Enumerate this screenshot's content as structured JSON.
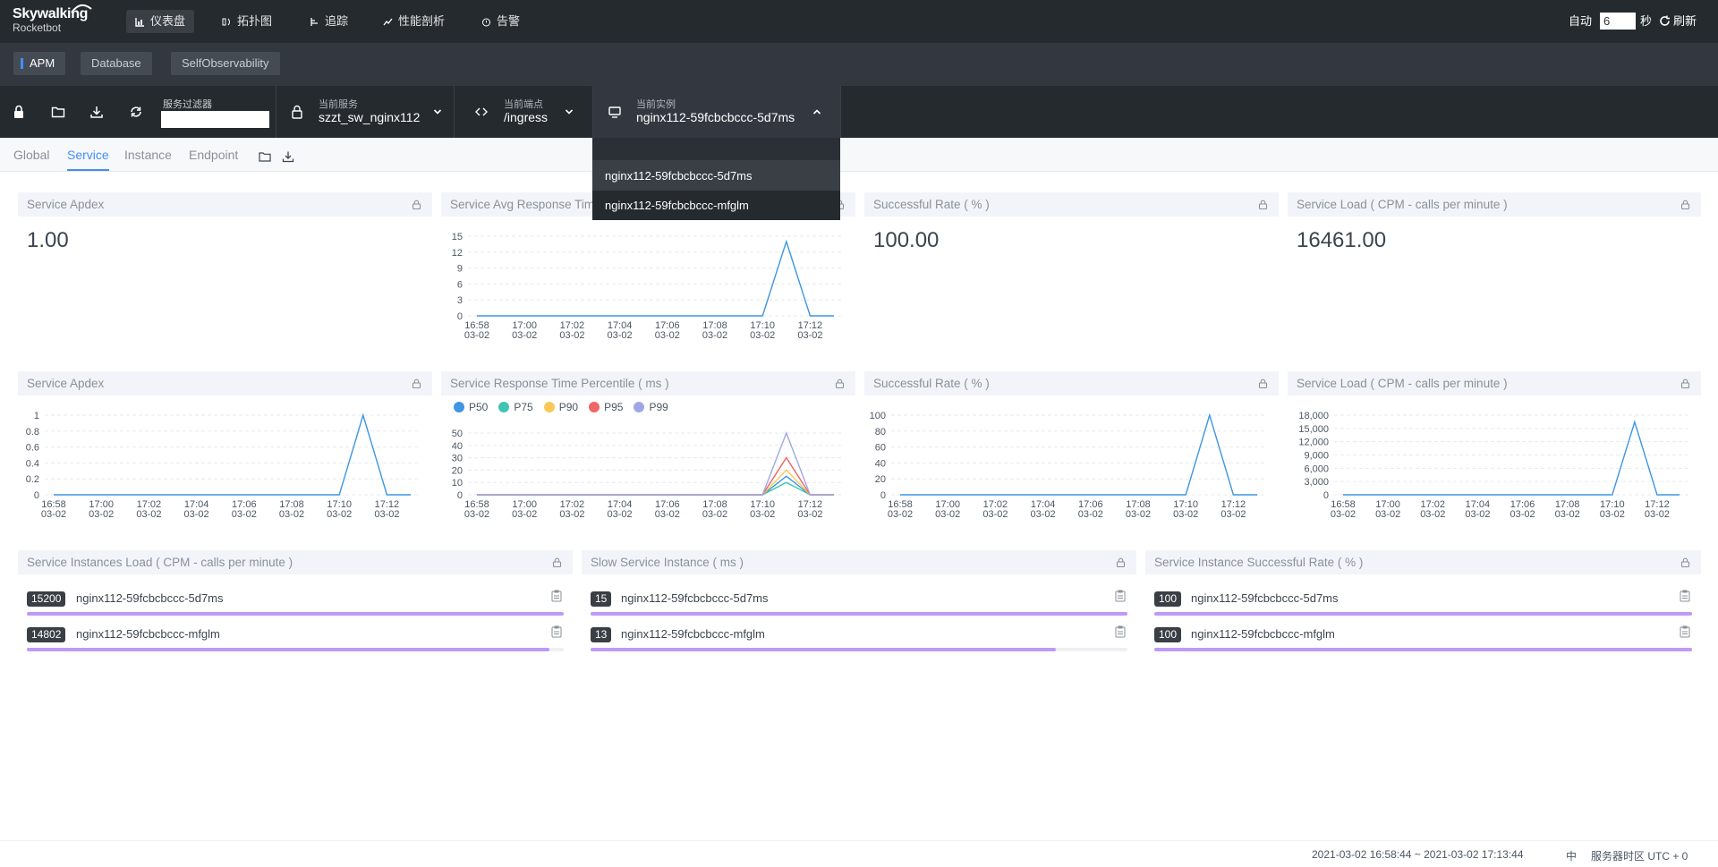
{
  "app": {
    "brand": "Skywalking",
    "sub": "Rocketbot"
  },
  "nav": [
    {
      "label": "仪表盘",
      "icon": "dashboard-icon"
    },
    {
      "label": "拓扑图",
      "icon": "topology-icon"
    },
    {
      "label": "追踪",
      "icon": "trace-icon"
    },
    {
      "label": "性能剖析",
      "icon": "profile-icon"
    },
    {
      "label": "告警",
      "icon": "alarm-icon"
    }
  ],
  "auto_refresh": {
    "auto_label": "自动",
    "interval": "6",
    "unit": "秒",
    "refresh_label": "刷新"
  },
  "subtabs": [
    "APM",
    "Database",
    "SelfObservability"
  ],
  "toolbar": {
    "filter_label": "服务过滤器",
    "service_label": "当前服务",
    "service_value": "szzt_sw_nginx112",
    "endpoint_label": "当前端点",
    "endpoint_value": "/ingress",
    "instance_label": "当前实例",
    "instance_value": "nginx112-59fcbcbccc-5d7ms"
  },
  "dropdown": {
    "items": [
      "nginx112-59fcbcbccc-5d7ms",
      "nginx112-59fcbcbccc-mfglm"
    ]
  },
  "dashtabs": [
    "Global",
    "Service",
    "Instance",
    "Endpoint"
  ],
  "panels": {
    "apdex_top": {
      "title": "Service Apdex",
      "value": "1.00"
    },
    "avg_resp": {
      "title": "Service Avg Response Time ( ms )"
    },
    "succ_top": {
      "title": "Successful Rate ( % )",
      "value": "100.00"
    },
    "load_top": {
      "title": "Service Load ( CPM - calls per minute )",
      "value": "16461.00"
    },
    "apdex_chart": {
      "title": "Service Apdex"
    },
    "percentile": {
      "title": "Service Response Time Percentile ( ms )"
    },
    "succ_chart": {
      "title": "Successful Rate ( % )"
    },
    "load_chart": {
      "title": "Service Load ( CPM - calls per minute )"
    }
  },
  "lists": {
    "load": {
      "title": "Service Instances Load ( CPM - calls per minute )",
      "rows": [
        {
          "value": "15200",
          "name": "nginx112-59fcbcbccc-5d7ms",
          "fill": 1.0
        },
        {
          "value": "14802",
          "name": "nginx112-59fcbcbccc-mfglm",
          "fill": 0.974
        }
      ]
    },
    "slow": {
      "title": "Slow Service Instance ( ms )",
      "rows": [
        {
          "value": "15",
          "name": "nginx112-59fcbcbccc-5d7ms",
          "fill": 1.0
        },
        {
          "value": "13",
          "name": "nginx112-59fcbcbccc-mfglm",
          "fill": 0.867
        }
      ]
    },
    "succ": {
      "title": "Service Instance Successful Rate ( % )",
      "rows": [
        {
          "value": "100",
          "name": "nginx112-59fcbcbccc-5d7ms",
          "fill": 1.0
        },
        {
          "value": "100",
          "name": "nginx112-59fcbcbccc-mfglm",
          "fill": 1.0
        }
      ]
    }
  },
  "footer": {
    "range": "2021-03-02 16:58:44 ~ 2021-03-02 17:13:44",
    "lang": "中",
    "timezone": "服务器时区 UTC + 0"
  },
  "chart_data": [
    {
      "type": "line",
      "x": [
        "16:58 03-02",
        "16:59 03-02",
        "17:00 03-02",
        "17:01 03-02",
        "17:02 03-02",
        "17:03 03-02",
        "17:04 03-02",
        "17:05 03-02",
        "17:06 03-02",
        "17:07 03-02",
        "17:08 03-02",
        "17:09 03-02",
        "17:10 03-02",
        "17:11 03-02",
        "17:12 03-02",
        "17:13 03-02"
      ],
      "x_ticks": [
        "16:58\n03-02",
        "17:00\n03-02",
        "17:02\n03-02",
        "17:04\n03-02",
        "17:06\n03-02",
        "17:08\n03-02",
        "17:10\n03-02",
        "17:12\n03-02"
      ],
      "series": [
        {
          "values": [
            0,
            0,
            0,
            0,
            0,
            0,
            0,
            0,
            0,
            0,
            0,
            0,
            0,
            14,
            0,
            0
          ],
          "color": "#3f96e3"
        }
      ],
      "y_ticks": [
        "0",
        "3",
        "6",
        "9",
        "12",
        "15"
      ],
      "ylim": [
        0,
        15
      ]
    },
    {
      "type": "line",
      "x": [
        "16:58 03-02",
        "16:59 03-02",
        "17:00 03-02",
        "17:01 03-02",
        "17:02 03-02",
        "17:03 03-02",
        "17:04 03-02",
        "17:05 03-02",
        "17:06 03-02",
        "17:07 03-02",
        "17:08 03-02",
        "17:09 03-02",
        "17:10 03-02",
        "17:11 03-02",
        "17:12 03-02",
        "17:13 03-02"
      ],
      "x_ticks": [
        "16:58\n03-02",
        "17:00\n03-02",
        "17:02\n03-02",
        "17:04\n03-02",
        "17:06\n03-02",
        "17:08\n03-02",
        "17:10\n03-02",
        "17:12\n03-02"
      ],
      "series": [
        {
          "values": [
            0,
            0,
            0,
            0,
            0,
            0,
            0,
            0,
            0,
            0,
            0,
            0,
            0,
            1,
            0,
            0
          ],
          "color": "#3f96e3"
        }
      ],
      "y_ticks": [
        "0",
        "0.2",
        "0.4",
        "0.6",
        "0.8",
        "1"
      ],
      "ylim": [
        0,
        1
      ]
    },
    {
      "type": "line",
      "x": [
        "16:58 03-02",
        "16:59 03-02",
        "17:00 03-02",
        "17:01 03-02",
        "17:02 03-02",
        "17:03 03-02",
        "17:04 03-02",
        "17:05 03-02",
        "17:06 03-02",
        "17:07 03-02",
        "17:08 03-02",
        "17:09 03-02",
        "17:10 03-02",
        "17:11 03-02",
        "17:12 03-02",
        "17:13 03-02"
      ],
      "x_ticks": [
        "16:58\n03-02",
        "17:00\n03-02",
        "17:02\n03-02",
        "17:04\n03-02",
        "17:06\n03-02",
        "17:08\n03-02",
        "17:10\n03-02",
        "17:12\n03-02"
      ],
      "legend": [
        "P50",
        "P75",
        "P90",
        "P95",
        "P99"
      ],
      "series": [
        {
          "name": "P50",
          "values": [
            0,
            0,
            0,
            0,
            0,
            0,
            0,
            0,
            0,
            0,
            0,
            0,
            0,
            15,
            0,
            0
          ],
          "color": "#3f96e3"
        },
        {
          "name": "P75",
          "values": [
            0,
            0,
            0,
            0,
            0,
            0,
            0,
            0,
            0,
            0,
            0,
            0,
            0,
            10,
            0,
            0
          ],
          "color": "#41c4b2"
        },
        {
          "name": "P90",
          "values": [
            0,
            0,
            0,
            0,
            0,
            0,
            0,
            0,
            0,
            0,
            0,
            0,
            0,
            20,
            0,
            0
          ],
          "color": "#fac858"
        },
        {
          "name": "P95",
          "values": [
            0,
            0,
            0,
            0,
            0,
            0,
            0,
            0,
            0,
            0,
            0,
            0,
            0,
            30,
            0,
            0
          ],
          "color": "#ee6666"
        },
        {
          "name": "P99",
          "values": [
            0,
            0,
            0,
            0,
            0,
            0,
            0,
            0,
            0,
            0,
            0,
            0,
            0,
            50,
            0,
            0
          ],
          "color": "#a0a7e6"
        }
      ],
      "y_ticks": [
        "0",
        "10",
        "20",
        "30",
        "40",
        "50"
      ],
      "ylim": [
        0,
        50
      ]
    },
    {
      "type": "line",
      "x": [
        "16:58 03-02",
        "16:59 03-02",
        "17:00 03-02",
        "17:01 03-02",
        "17:02 03-02",
        "17:03 03-02",
        "17:04 03-02",
        "17:05 03-02",
        "17:06 03-02",
        "17:07 03-02",
        "17:08 03-02",
        "17:09 03-02",
        "17:10 03-02",
        "17:11 03-02",
        "17:12 03-02",
        "17:13 03-02"
      ],
      "x_ticks": [
        "16:58\n03-02",
        "17:00\n03-02",
        "17:02\n03-02",
        "17:04\n03-02",
        "17:06\n03-02",
        "17:08\n03-02",
        "17:10\n03-02",
        "17:12\n03-02"
      ],
      "series": [
        {
          "values": [
            0,
            0,
            0,
            0,
            0,
            0,
            0,
            0,
            0,
            0,
            0,
            0,
            0,
            100,
            0,
            0
          ],
          "color": "#3f96e3"
        }
      ],
      "y_ticks": [
        "0",
        "20",
        "40",
        "60",
        "80",
        "100"
      ],
      "ylim": [
        0,
        100
      ]
    },
    {
      "type": "line",
      "x": [
        "16:58 03-02",
        "16:59 03-02",
        "17:00 03-02",
        "17:01 03-02",
        "17:02 03-02",
        "17:03 03-02",
        "17:04 03-02",
        "17:05 03-02",
        "17:06 03-02",
        "17:07 03-02",
        "17:08 03-02",
        "17:09 03-02",
        "17:10 03-02",
        "17:11 03-02",
        "17:12 03-02",
        "17:13 03-02"
      ],
      "x_ticks": [
        "16:58\n03-02",
        "17:00\n03-02",
        "17:02\n03-02",
        "17:04\n03-02",
        "17:06\n03-02",
        "17:08\n03-02",
        "17:10\n03-02",
        "17:12\n03-02"
      ],
      "series": [
        {
          "values": [
            0,
            0,
            0,
            0,
            0,
            0,
            0,
            0,
            0,
            0,
            0,
            0,
            0,
            16461,
            0,
            0
          ],
          "color": "#3f96e3"
        }
      ],
      "y_ticks": [
        "0",
        "3,000",
        "6,000",
        "9,000",
        "12,000",
        "15,000",
        "18,000"
      ],
      "ylim": [
        0,
        18000
      ]
    }
  ]
}
